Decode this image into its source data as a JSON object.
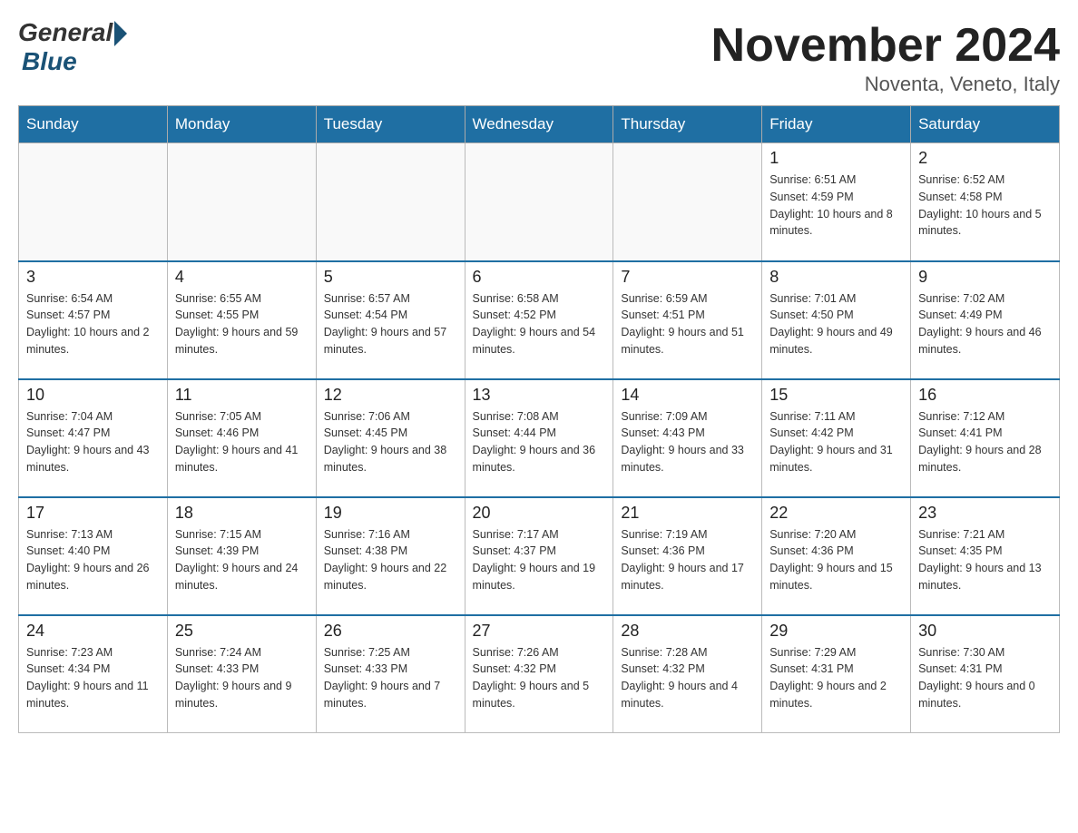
{
  "header": {
    "logo_general": "General",
    "logo_blue": "Blue",
    "month_title": "November 2024",
    "subtitle": "Noventa, Veneto, Italy"
  },
  "weekdays": [
    "Sunday",
    "Monday",
    "Tuesday",
    "Wednesday",
    "Thursday",
    "Friday",
    "Saturday"
  ],
  "weeks": [
    [
      {
        "day": "",
        "sunrise": "",
        "sunset": "",
        "daylight": ""
      },
      {
        "day": "",
        "sunrise": "",
        "sunset": "",
        "daylight": ""
      },
      {
        "day": "",
        "sunrise": "",
        "sunset": "",
        "daylight": ""
      },
      {
        "day": "",
        "sunrise": "",
        "sunset": "",
        "daylight": ""
      },
      {
        "day": "",
        "sunrise": "",
        "sunset": "",
        "daylight": ""
      },
      {
        "day": "1",
        "sunrise": "Sunrise: 6:51 AM",
        "sunset": "Sunset: 4:59 PM",
        "daylight": "Daylight: 10 hours and 8 minutes."
      },
      {
        "day": "2",
        "sunrise": "Sunrise: 6:52 AM",
        "sunset": "Sunset: 4:58 PM",
        "daylight": "Daylight: 10 hours and 5 minutes."
      }
    ],
    [
      {
        "day": "3",
        "sunrise": "Sunrise: 6:54 AM",
        "sunset": "Sunset: 4:57 PM",
        "daylight": "Daylight: 10 hours and 2 minutes."
      },
      {
        "day": "4",
        "sunrise": "Sunrise: 6:55 AM",
        "sunset": "Sunset: 4:55 PM",
        "daylight": "Daylight: 9 hours and 59 minutes."
      },
      {
        "day": "5",
        "sunrise": "Sunrise: 6:57 AM",
        "sunset": "Sunset: 4:54 PM",
        "daylight": "Daylight: 9 hours and 57 minutes."
      },
      {
        "day": "6",
        "sunrise": "Sunrise: 6:58 AM",
        "sunset": "Sunset: 4:52 PM",
        "daylight": "Daylight: 9 hours and 54 minutes."
      },
      {
        "day": "7",
        "sunrise": "Sunrise: 6:59 AM",
        "sunset": "Sunset: 4:51 PM",
        "daylight": "Daylight: 9 hours and 51 minutes."
      },
      {
        "day": "8",
        "sunrise": "Sunrise: 7:01 AM",
        "sunset": "Sunset: 4:50 PM",
        "daylight": "Daylight: 9 hours and 49 minutes."
      },
      {
        "day": "9",
        "sunrise": "Sunrise: 7:02 AM",
        "sunset": "Sunset: 4:49 PM",
        "daylight": "Daylight: 9 hours and 46 minutes."
      }
    ],
    [
      {
        "day": "10",
        "sunrise": "Sunrise: 7:04 AM",
        "sunset": "Sunset: 4:47 PM",
        "daylight": "Daylight: 9 hours and 43 minutes."
      },
      {
        "day": "11",
        "sunrise": "Sunrise: 7:05 AM",
        "sunset": "Sunset: 4:46 PM",
        "daylight": "Daylight: 9 hours and 41 minutes."
      },
      {
        "day": "12",
        "sunrise": "Sunrise: 7:06 AM",
        "sunset": "Sunset: 4:45 PM",
        "daylight": "Daylight: 9 hours and 38 minutes."
      },
      {
        "day": "13",
        "sunrise": "Sunrise: 7:08 AM",
        "sunset": "Sunset: 4:44 PM",
        "daylight": "Daylight: 9 hours and 36 minutes."
      },
      {
        "day": "14",
        "sunrise": "Sunrise: 7:09 AM",
        "sunset": "Sunset: 4:43 PM",
        "daylight": "Daylight: 9 hours and 33 minutes."
      },
      {
        "day": "15",
        "sunrise": "Sunrise: 7:11 AM",
        "sunset": "Sunset: 4:42 PM",
        "daylight": "Daylight: 9 hours and 31 minutes."
      },
      {
        "day": "16",
        "sunrise": "Sunrise: 7:12 AM",
        "sunset": "Sunset: 4:41 PM",
        "daylight": "Daylight: 9 hours and 28 minutes."
      }
    ],
    [
      {
        "day": "17",
        "sunrise": "Sunrise: 7:13 AM",
        "sunset": "Sunset: 4:40 PM",
        "daylight": "Daylight: 9 hours and 26 minutes."
      },
      {
        "day": "18",
        "sunrise": "Sunrise: 7:15 AM",
        "sunset": "Sunset: 4:39 PM",
        "daylight": "Daylight: 9 hours and 24 minutes."
      },
      {
        "day": "19",
        "sunrise": "Sunrise: 7:16 AM",
        "sunset": "Sunset: 4:38 PM",
        "daylight": "Daylight: 9 hours and 22 minutes."
      },
      {
        "day": "20",
        "sunrise": "Sunrise: 7:17 AM",
        "sunset": "Sunset: 4:37 PM",
        "daylight": "Daylight: 9 hours and 19 minutes."
      },
      {
        "day": "21",
        "sunrise": "Sunrise: 7:19 AM",
        "sunset": "Sunset: 4:36 PM",
        "daylight": "Daylight: 9 hours and 17 minutes."
      },
      {
        "day": "22",
        "sunrise": "Sunrise: 7:20 AM",
        "sunset": "Sunset: 4:36 PM",
        "daylight": "Daylight: 9 hours and 15 minutes."
      },
      {
        "day": "23",
        "sunrise": "Sunrise: 7:21 AM",
        "sunset": "Sunset: 4:35 PM",
        "daylight": "Daylight: 9 hours and 13 minutes."
      }
    ],
    [
      {
        "day": "24",
        "sunrise": "Sunrise: 7:23 AM",
        "sunset": "Sunset: 4:34 PM",
        "daylight": "Daylight: 9 hours and 11 minutes."
      },
      {
        "day": "25",
        "sunrise": "Sunrise: 7:24 AM",
        "sunset": "Sunset: 4:33 PM",
        "daylight": "Daylight: 9 hours and 9 minutes."
      },
      {
        "day": "26",
        "sunrise": "Sunrise: 7:25 AM",
        "sunset": "Sunset: 4:33 PM",
        "daylight": "Daylight: 9 hours and 7 minutes."
      },
      {
        "day": "27",
        "sunrise": "Sunrise: 7:26 AM",
        "sunset": "Sunset: 4:32 PM",
        "daylight": "Daylight: 9 hours and 5 minutes."
      },
      {
        "day": "28",
        "sunrise": "Sunrise: 7:28 AM",
        "sunset": "Sunset: 4:32 PM",
        "daylight": "Daylight: 9 hours and 4 minutes."
      },
      {
        "day": "29",
        "sunrise": "Sunrise: 7:29 AM",
        "sunset": "Sunset: 4:31 PM",
        "daylight": "Daylight: 9 hours and 2 minutes."
      },
      {
        "day": "30",
        "sunrise": "Sunrise: 7:30 AM",
        "sunset": "Sunset: 4:31 PM",
        "daylight": "Daylight: 9 hours and 0 minutes."
      }
    ]
  ]
}
